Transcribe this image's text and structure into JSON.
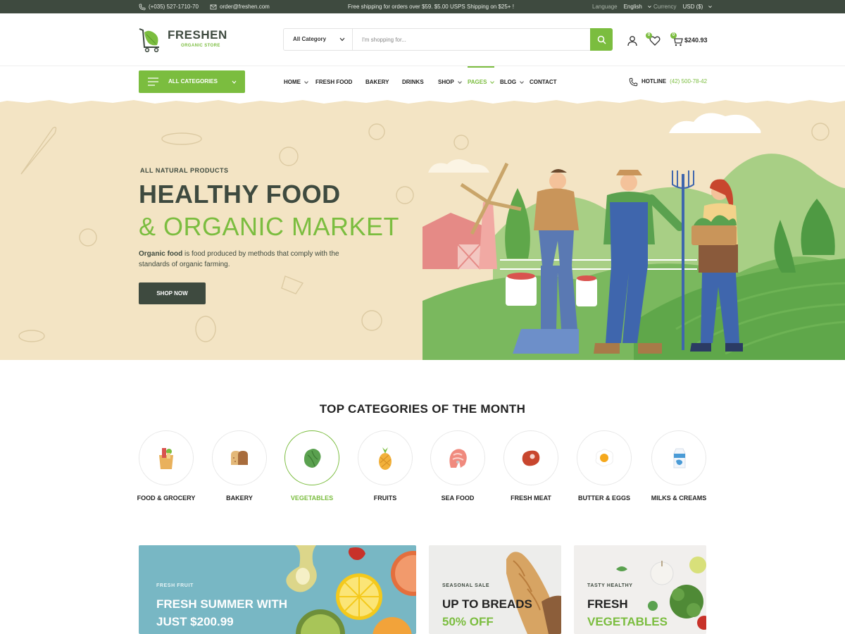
{
  "topbar": {
    "phone": "(+035) 527-1710-70",
    "email": "order@freshen.com",
    "promo": "Free shipping for orders over $59. $5.00 USPS Shipping on $25+ !",
    "language_label": "Language",
    "language_value": "English",
    "currency_label": "Currency",
    "currency_value": "USD ($)"
  },
  "logo": {
    "name": "FRESHEN",
    "tagline": "ORGANIC STORE"
  },
  "search": {
    "category": "All Category",
    "placeholder": "I'm shopping for..."
  },
  "header": {
    "wishlist_count": "0",
    "cart_count": "0",
    "cart_total": "$240.93"
  },
  "nav": {
    "all_categories": "ALL CATEGORIES",
    "items": [
      {
        "label": "HOME"
      },
      {
        "label": "FRESH FOOD"
      },
      {
        "label": "BAKERY"
      },
      {
        "label": "DRINKS"
      },
      {
        "label": "SHOP"
      },
      {
        "label": "PAGES"
      },
      {
        "label": "BLOG"
      },
      {
        "label": "CONTACT"
      }
    ],
    "hotline_label": "HOTLINE",
    "hotline_number": "(42) 500-78-42"
  },
  "hero": {
    "subtitle": "ALL NATURAL PRODUCTS",
    "title_line1": "HEALTHY FOOD",
    "title_line2": "& ORGANIC MARKET",
    "desc_bold": "Organic food",
    "desc_rest": " is food produced by methods that comply with the standards of organic farming.",
    "button": "SHOP NOW"
  },
  "categories": {
    "title": "TOP CATEGORIES OF THE MONTH",
    "items": [
      {
        "label": "FOOD & GROCERY",
        "icon": "grocery-bag-icon"
      },
      {
        "label": "BAKERY",
        "icon": "bread-icon"
      },
      {
        "label": "VEGETABLES",
        "icon": "lettuce-icon",
        "active": true
      },
      {
        "label": "FRUITS",
        "icon": "pineapple-icon"
      },
      {
        "label": "SEA FOOD",
        "icon": "salmon-steak-icon"
      },
      {
        "label": "FRESH MEAT",
        "icon": "steak-icon"
      },
      {
        "label": "BUTTER & EGGS",
        "icon": "fried-egg-icon"
      },
      {
        "label": "MILKS & CREAMS",
        "icon": "milk-carton-icon"
      }
    ]
  },
  "banners": [
    {
      "kicker": "FRESH FRUIT",
      "line1": "FRESH SUMMER WITH",
      "line2": "JUST $200.99"
    },
    {
      "kicker": "SEASONAL SALE",
      "line1": "UP TO BREADS",
      "line2": "50% OFF"
    },
    {
      "kicker": "TASTY HEALTHY",
      "line1": "FRESH",
      "line2": "VEGETABLES"
    }
  ],
  "colors": {
    "brand_green": "#7bbd3f",
    "dark_green": "#3e4a3f",
    "hero_bg": "#f3e4c4"
  }
}
